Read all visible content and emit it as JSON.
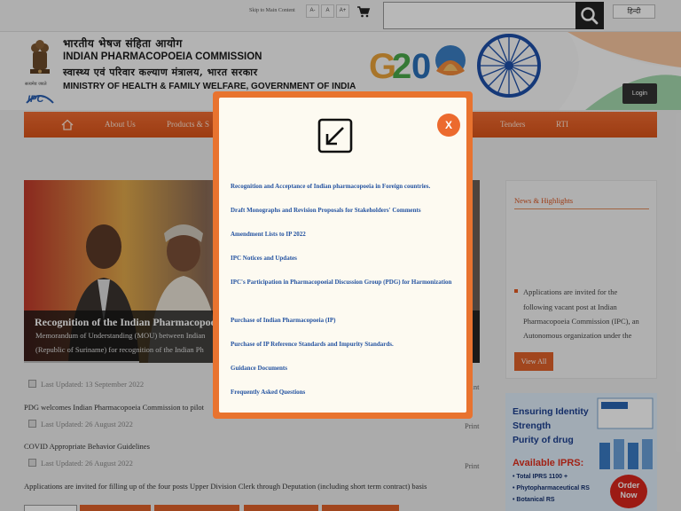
{
  "topbar": {
    "skip_label": "Skip to Main Content",
    "font_buttons": [
      "A-",
      "A",
      "A+"
    ],
    "language_label": "हिन्दी",
    "search_placeholder": ""
  },
  "header": {
    "org_hindi_1": "भारतीय भेषज संहिता आयोग",
    "org_english_1": "INDIAN PHARMACOPOEIA COMMISSION",
    "org_hindi_2": "स्वास्थ्य एवं परिवार कल्याण मंत्रालय, भारत सरकार",
    "org_english_2": "MINISTRY OF HEALTH & FAMILY WELFARE, GOVERNMENT OF INDIA",
    "emblem_caption": "सत्यमेव जयते",
    "ipc_logo_text": "IPC",
    "login_label": "Login"
  },
  "nav": {
    "items": [
      "About Us",
      "Products & S",
      "Tenders",
      "RTI"
    ]
  },
  "slider": {
    "title": "Recognition of the Indian Pharmacopoei",
    "text_1": "Memorandum of Understanding (MOU) between Indian",
    "text_2": "(Republic of Suriname) for recognition of the Indian Ph"
  },
  "news_list": [
    {
      "updated": "Last Updated: 13 September 2022",
      "title": "PDG welcomes Indian Pharmacopoeia Commission to pilot",
      "print": "Print"
    },
    {
      "updated": "Last Updated: 26 August 2022",
      "title": "COVID Appropriate Behavior Guidelines",
      "print": "Print"
    },
    {
      "updated": "Last Updated: 26 August 2022",
      "title": "Applications are invited for filling up of the four posts Upper Division Clerk through Deputation (including short term contract) basis",
      "print": "Print"
    }
  ],
  "sidebar": {
    "news_heading": "News & Highlights",
    "news_lines": [
      "Applications are invited for the",
      "following vacant post at Indian",
      "Pharmacopoeia Commission (IPC), an",
      "Autonomous organization under the"
    ],
    "view_all": "View All"
  },
  "ad": {
    "line1": "Ensuring Identity",
    "line2": "Strength",
    "line3": "Purity of drug",
    "available": "Available IPRS:",
    "bullets": [
      "• Total IPRS 1100 +",
      "• Phytopharmaceutical RS",
      "• Botanical RS"
    ],
    "order": "Order Now"
  },
  "modal": {
    "close_label": "X",
    "links": [
      "Recognition and Acceptance of Indian pharmacopoeia in Foreign countries.",
      "Draft Monographs and Revision Proposals for Stakeholders' Comments",
      "Amendment Lists to IP 2022",
      "IPC Notices and Updates",
      "IPC's Participation in Pharmacopoeial Discussion Group (PDG) for Harmonization",
      "Purchase of Indian Pharmacopoeia (IP)",
      "Purchase of IP Reference Standards and Impurity Standards.",
      "Guidance Documents",
      "Frequently Asked Questions"
    ]
  },
  "colors": {
    "accent_orange": "#e8732f",
    "link_blue": "#2352a0",
    "nav_orange": "#e45b22"
  }
}
